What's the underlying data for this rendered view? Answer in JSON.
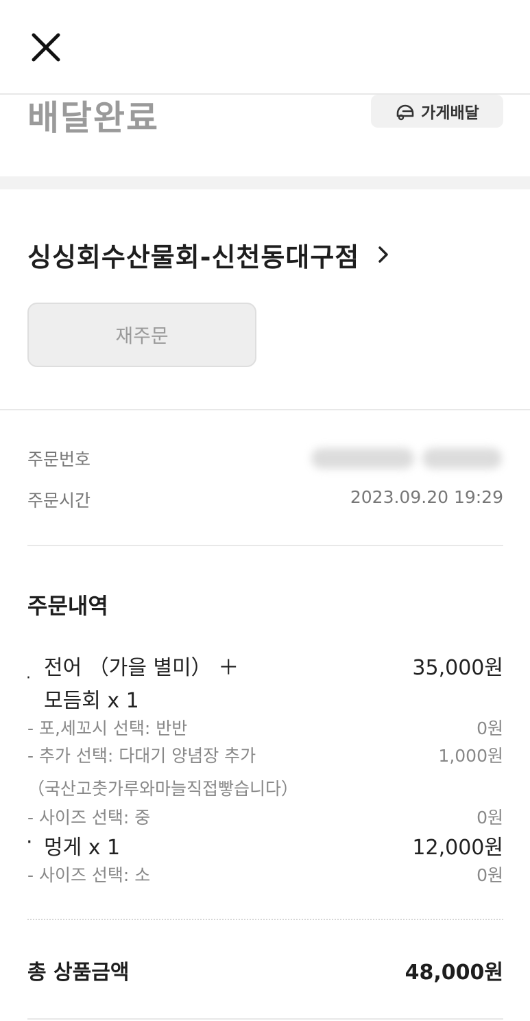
{
  "header": {
    "close_icon": "close-icon"
  },
  "status": {
    "title": "배달완료",
    "badge_label": "가게배달",
    "badge_icon": "helmet-icon"
  },
  "store": {
    "name": "싱싱회수산물회-신천동대구점",
    "chevron_icon": "chevron-right-icon"
  },
  "reorder": {
    "label": "재주문"
  },
  "order_info": {
    "number_label": "주문번호",
    "time_label": "주문시간",
    "time_value": "2023.09.20 19:29"
  },
  "order_details": {
    "title": "주문내역",
    "items": [
      {
        "name_line1": "전어 （가을 별미） ＋",
        "name_line2": "모듬회 x 1",
        "price": "35,000원",
        "options": [
          {
            "label": "- 포,세꼬시 선택: 반반",
            "price": "0원"
          },
          {
            "label": "- 추가 선택: 다대기 양념장 추가",
            "price": "1,000원"
          },
          {
            "label": "（국산고춧가루와마늘직접빻습니다）",
            "price": ""
          },
          {
            "label": "- 사이즈 선택: 중",
            "price": "0원"
          }
        ]
      },
      {
        "name_line1": "멍게 x 1",
        "price": "12,000원",
        "options": [
          {
            "label": "- 사이즈 선택: 소",
            "price": "0원"
          }
        ]
      }
    ]
  },
  "total": {
    "label": "총 상품금액",
    "value": "48,000원"
  },
  "colors": {
    "muted": "#9a9a9a",
    "text": "#222222",
    "divider": "#e8e8e8"
  }
}
